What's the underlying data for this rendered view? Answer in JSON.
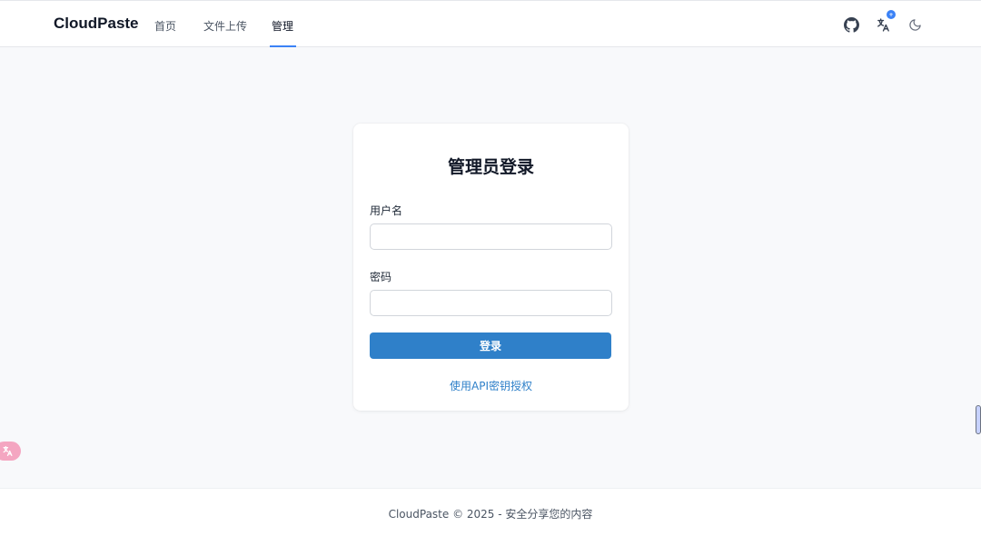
{
  "header": {
    "brand": "CloudPaste",
    "nav": [
      {
        "label": "首页"
      },
      {
        "label": "文件上传"
      },
      {
        "label": "管理"
      }
    ],
    "active_nav": "管理",
    "icons": [
      "github-icon",
      "translate-icon",
      "moon-icon"
    ],
    "translate_badge": "+"
  },
  "login": {
    "title": "管理员登录",
    "username_label": "用户名",
    "username_value": "",
    "password_label": "密码",
    "password_value": "",
    "submit_label": "登录",
    "api_link": "使用API密钥授权"
  },
  "footer": {
    "text": "CloudPaste © 2025 - 安全分享您的内容"
  },
  "colors": {
    "accent": "#2f80c9",
    "background": "#f8f9fb",
    "nav_underline": "#3b82f6"
  }
}
